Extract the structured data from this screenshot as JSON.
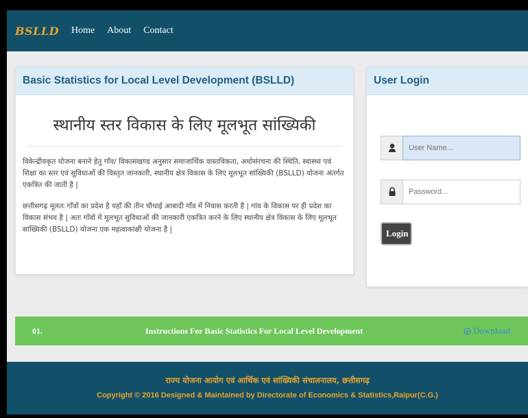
{
  "navbar": {
    "brand": "BSLLD",
    "links": [
      "Home",
      "About",
      "Contact"
    ]
  },
  "info_panel": {
    "heading": "Basic Statistics for Local Level Development (BSLLD)",
    "hindi_title": "स्थानीय स्तर विकास के लिए मूलभूत सांख्यिकी",
    "paragraph1": "विकेन्द्रीयकृत योजना बनाने हेतु गाँव/ विकासखण्ड अनुसार समाजार्थिक वास्तविकता, अधोसंरचना की स्थिति, स्वास्थ्य एवं शिक्षा का स्तर एवं सुविधाओं की विस्तृत जानकारी, स्थानीय क्षेत्र विकास के लिए मूलभूत सांख्यिकी (BSLLD) योजना अंतर्गत एकत्रित की जाती है |",
    "paragraph2": "छत्तीसगढ़ मूलतः गाँवों का प्रदेश है यहाँ की तीन चौथाई आबादी गाँव में निवास करती है | गांव के विकास पर ही प्रदेश का विकास संभव है | अतः गाँवों में मूलभूत सुविधाओं की जानकारी एकत्रित करने के लिए स्थानीय क्षेत्र विकास के लिए मूलभूत सांख्यिकी (BSLLD) योजना एक महत्वाकांक्षी योजना है |"
  },
  "login_panel": {
    "heading": "User Login",
    "username_placeholder": "User Name...",
    "password_placeholder": "Password...",
    "login_label": "Login",
    "user_icon": "user-icon",
    "lock_icon": "lock-icon"
  },
  "instructions": {
    "number": "01.",
    "title": "Instructions For Basic Statistics For Local Level Development",
    "download_label": "Download",
    "download_icon": "download-circle-icon"
  },
  "footer": {
    "line1": "राज्य योजना आयोग  एवं  आर्थिक एवं सांख्यिकी संचालनालय, छत्तीसगढ़",
    "line2": "Copyright © 2016 Designed & Maintained by Directorate of Economics & Statistics,Raipur(C.G.)"
  },
  "colors": {
    "navbar": "#125069",
    "brand": "#e8a32e",
    "panel_heading_bg": "#dcecf6",
    "panel_heading_text": "#1f5f80",
    "instructions_bar": "#6ec65b",
    "download_link": "#3a89c9",
    "footer_text": "#e8a32e"
  }
}
